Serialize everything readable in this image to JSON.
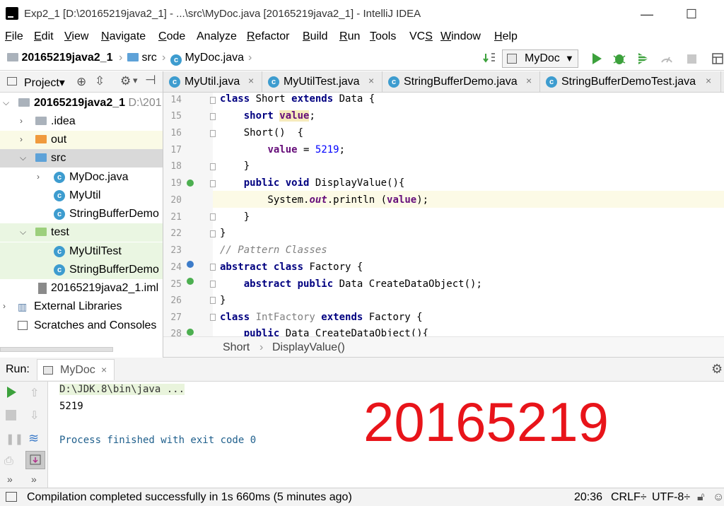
{
  "window": {
    "title": "Exp2_1 [D:\\20165219java2_1] - ...\\src\\MyDoc.java [20165219java2_1] - IntelliJ IDEA",
    "minimize": "—",
    "maximize": "☐"
  },
  "menu": [
    {
      "u": "F",
      "rest": "ile"
    },
    {
      "u": "E",
      "rest": "dit"
    },
    {
      "u": "V",
      "rest": "iew"
    },
    {
      "u": "N",
      "rest": "avigate"
    },
    {
      "u": "C",
      "rest": "ode"
    },
    {
      "u": "",
      "rest": "Analyze"
    },
    {
      "u": "R",
      "rest": "efactor"
    },
    {
      "u": "B",
      "rest": "uild"
    },
    {
      "u": "",
      "rest": "Run",
      "ru": "R"
    },
    {
      "u": "T",
      "rest": "ools"
    },
    {
      "u": "",
      "rest": "VCS",
      "vs": "S"
    },
    {
      "u": "W",
      "rest": "indow"
    },
    {
      "u": "H",
      "rest": "elp"
    }
  ],
  "navbar": {
    "project": "20165219java2_1",
    "folder": "src",
    "file": "MyDoc.java",
    "run_config": "MyDoc"
  },
  "project_panel": {
    "title": "Project",
    "dropdown": "▾",
    "tree": [
      {
        "label": "20165219java2_1",
        "suffix": "D:\\201",
        "bold": true
      },
      {
        "label": ".idea"
      },
      {
        "label": "out"
      },
      {
        "label": "src"
      },
      {
        "label": "MyDoc.java"
      },
      {
        "label": "MyUtil"
      },
      {
        "label": "StringBufferDemo"
      },
      {
        "label": "test"
      },
      {
        "label": "MyUtilTest"
      },
      {
        "label": "StringBufferDemo"
      },
      {
        "label": "20165219java2_1.iml"
      },
      {
        "label": "External Libraries"
      },
      {
        "label": "Scratches and Consoles"
      }
    ]
  },
  "tabs": [
    {
      "label": "MyUtil.java"
    },
    {
      "label": "MyUtilTest.java"
    },
    {
      "label": "StringBufferDemo.java"
    },
    {
      "label": "StringBufferDemoTest.java"
    }
  ],
  "tab_close": "×",
  "editor": {
    "line_numbers": [
      "14",
      "15",
      "16",
      "17",
      "18",
      "19",
      "20",
      "21",
      "22",
      "23",
      "24",
      "25",
      "26",
      "27",
      "28"
    ],
    "tokens": {
      "l14": [
        "class ",
        "Short ",
        "extends ",
        "Data {"
      ],
      "l15": [
        "    ",
        "short ",
        "value",
        ";"
      ],
      "l16": [
        "    Short()  {"
      ],
      "l17": [
        "        ",
        "value",
        " = ",
        "5219",
        ";"
      ],
      "l18": [
        "    }"
      ],
      "l19": [
        "    ",
        "public void ",
        "DisplayValue(){"
      ],
      "l20": [
        "        System.",
        "out",
        ".println (",
        "value",
        ");"
      ],
      "l21": [
        "    }"
      ],
      "l22": [
        "}"
      ],
      "l23": [
        "// Pattern Classes"
      ],
      "l24": [
        "abstract class ",
        "Factory {"
      ],
      "l25": [
        "    ",
        "abstract public ",
        "Data CreateDataObject();"
      ],
      "l26": [
        "}"
      ],
      "l27": [
        "class ",
        "IntFactory ",
        "extends ",
        "Factory {"
      ],
      "l28": [
        "    ",
        "public ",
        "Data CreateDataObject(){"
      ]
    },
    "breadcrumb": [
      "Short",
      "›",
      "DisplayValue()"
    ]
  },
  "run_panel": {
    "label": "Run:",
    "tab": "MyDoc",
    "close": "×",
    "output": [
      "D:\\JDK.8\\bin\\java ...",
      "5219",
      "",
      "Process finished with exit code 0"
    ],
    "overlay_text": "20165219",
    "overlay_color": "#e8141a"
  },
  "statusbar": {
    "message": "Compilation completed successfully in 1s 660ms (5 minutes ago)",
    "position": "20:36",
    "line_sep": "CRLF÷",
    "encoding": "UTF-8÷"
  },
  "colors": {
    "accent": "#3d9ccf",
    "run_green": "#3ca13c",
    "keyword": "#000080",
    "field": "#660e7a",
    "number": "#0000ff"
  }
}
